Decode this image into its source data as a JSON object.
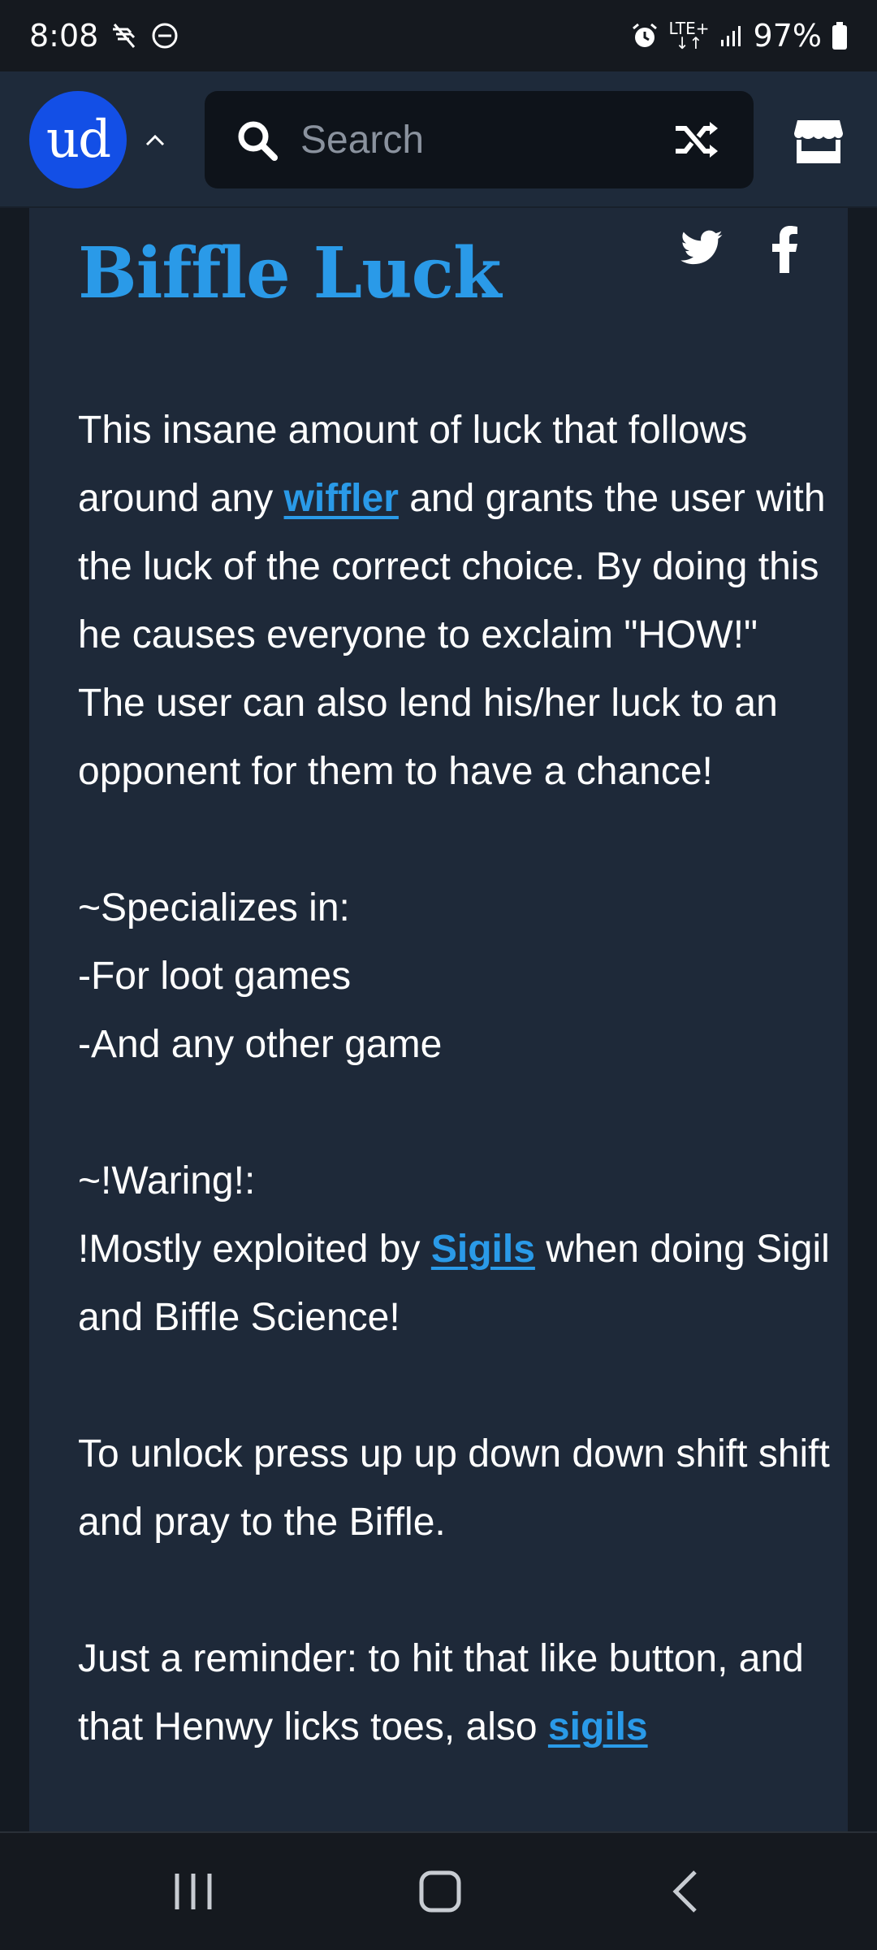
{
  "status_bar": {
    "time": "8:08",
    "network": "LTE+",
    "battery": "97%",
    "icons": [
      "no-disturb-icon",
      "dnd-icon",
      "alarm-icon",
      "signal-icon",
      "battery-icon"
    ]
  },
  "header": {
    "logo_text": "ud",
    "search_placeholder": "Search",
    "icons": [
      "chevron-up-icon",
      "search-icon",
      "shuffle-icon",
      "store-icon"
    ]
  },
  "definition": {
    "title": "Biffle Luck",
    "share_icons": [
      "twitter-icon",
      "facebook-icon"
    ],
    "p1_before": "This insane amount of luck that follows around any ",
    "p1_link": "wiffler",
    "p1_after": " and grants the user with the luck of the correct choice. By doing this he causes everyone to exclaim \"HOW!\" The user can also lend his/her luck to an opponent for them to have a chance!",
    "specializes_heading": "~Specializes in:",
    "specializes_item1": "-For loot games",
    "specializes_item2": "-And any other game",
    "warning_heading": "~!Waring!:",
    "warning_before": "!Mostly exploited by ",
    "warning_link": "Sigils",
    "warning_after": " when doing Sigil and Biffle Science!",
    "unlock_text": "To unlock press up up down down shift shift and pray to the Biffle.",
    "reminder_before": "Just a reminder: to hit that like button, and that Henwy licks toes, also ",
    "reminder_link": "sigils"
  },
  "colors": {
    "brand_blue": "#134fe6",
    "link_blue": "#2a9ae8",
    "card_bg": "#1e2939",
    "header_bg": "#1e2a3a"
  },
  "nav_bar": {
    "icons": [
      "recents-icon",
      "home-icon",
      "back-icon"
    ]
  }
}
